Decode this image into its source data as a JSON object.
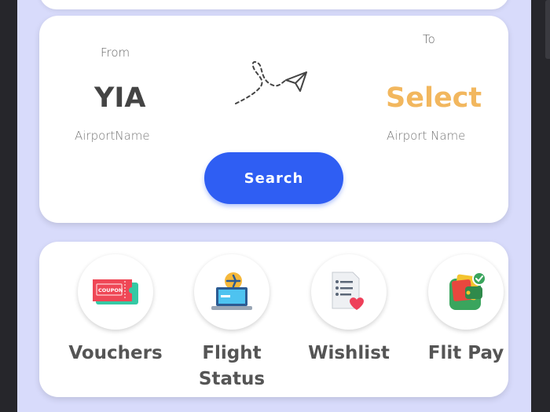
{
  "flight_search": {
    "from_label": "From",
    "from_code": "YIA",
    "from_airport_name": "AirportName",
    "to_label": "To",
    "to_code": "Select",
    "to_airport_name": "Airport Name",
    "search_button": "Search"
  },
  "services": [
    {
      "label": "Vouchers",
      "icon": "coupon-ticket-icon"
    },
    {
      "label": "Flight\nStatus",
      "icon": "flight-status-laptop-icon"
    },
    {
      "label": "Wishlist",
      "icon": "wishlist-list-heart-icon"
    },
    {
      "label": "Flit Pay",
      "icon": "wallet-icon"
    }
  ],
  "colors": {
    "background": "#d8dbfb",
    "primary": "#2f5ef3",
    "accent": "#f2b75e",
    "text_dark": "#444444"
  }
}
